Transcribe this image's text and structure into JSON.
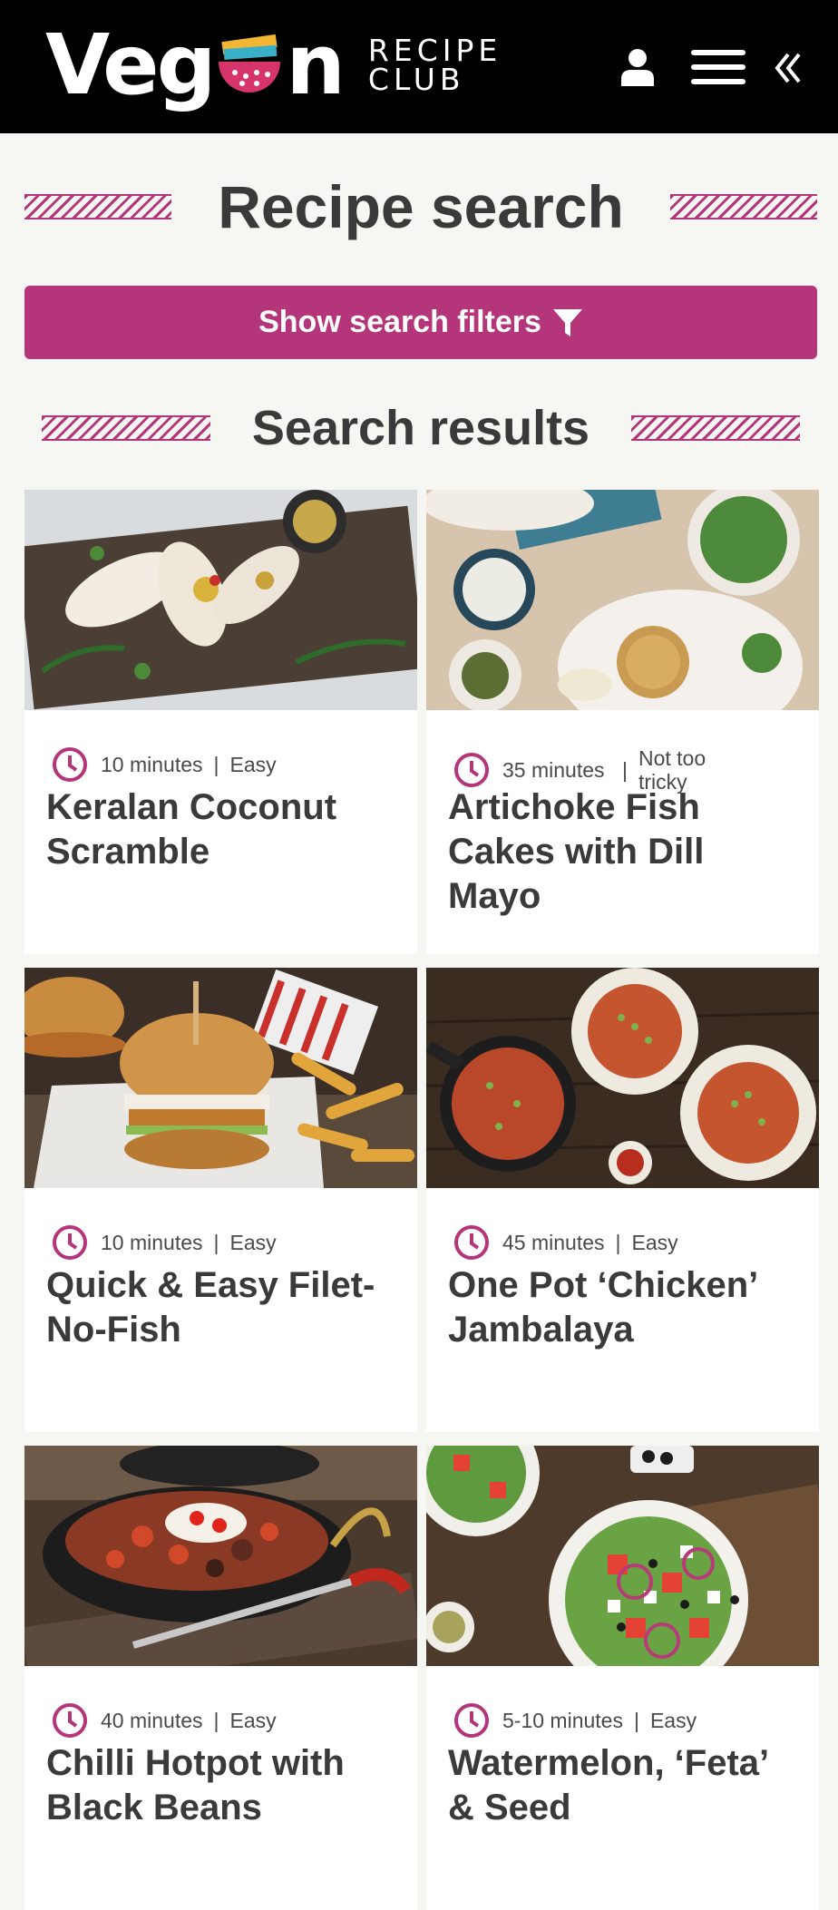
{
  "brand": {
    "word_left": "Veg",
    "word_right": "n",
    "tagline_1": "RECIPE",
    "tagline_2": "CLUB"
  },
  "header": {
    "icons": [
      "user-icon",
      "menu-icon",
      "chevrons-left-icon"
    ]
  },
  "page": {
    "title": "Recipe search"
  },
  "filters": {
    "button_label": "Show search filters",
    "icon": "filter-icon"
  },
  "results": {
    "title": "Search results"
  },
  "colors": {
    "accent": "#b5357a",
    "topbar": "#000000",
    "background": "#f6f6f2"
  },
  "recipes": [
    {
      "time": "10 minutes",
      "difficulty": "Easy",
      "title": "Keralan Coconut Scramble"
    },
    {
      "time": "35 minutes",
      "difficulty": "Not too tricky",
      "title": "Artichoke Fish Cakes with Dill Mayo"
    },
    {
      "time": "10 minutes",
      "difficulty": "Easy",
      "title": "Quick & Easy Filet-No-Fish"
    },
    {
      "time": "45 minutes",
      "difficulty": "Easy",
      "title": "One Pot ‘Chicken’ Jambalaya"
    },
    {
      "time": "40 minutes",
      "difficulty": "Easy",
      "title": "Chilli Hotpot with Black Beans"
    },
    {
      "time": "5-10 minutes",
      "difficulty": "Easy",
      "title": "Watermelon, ‘Feta’ & Seed"
    }
  ]
}
